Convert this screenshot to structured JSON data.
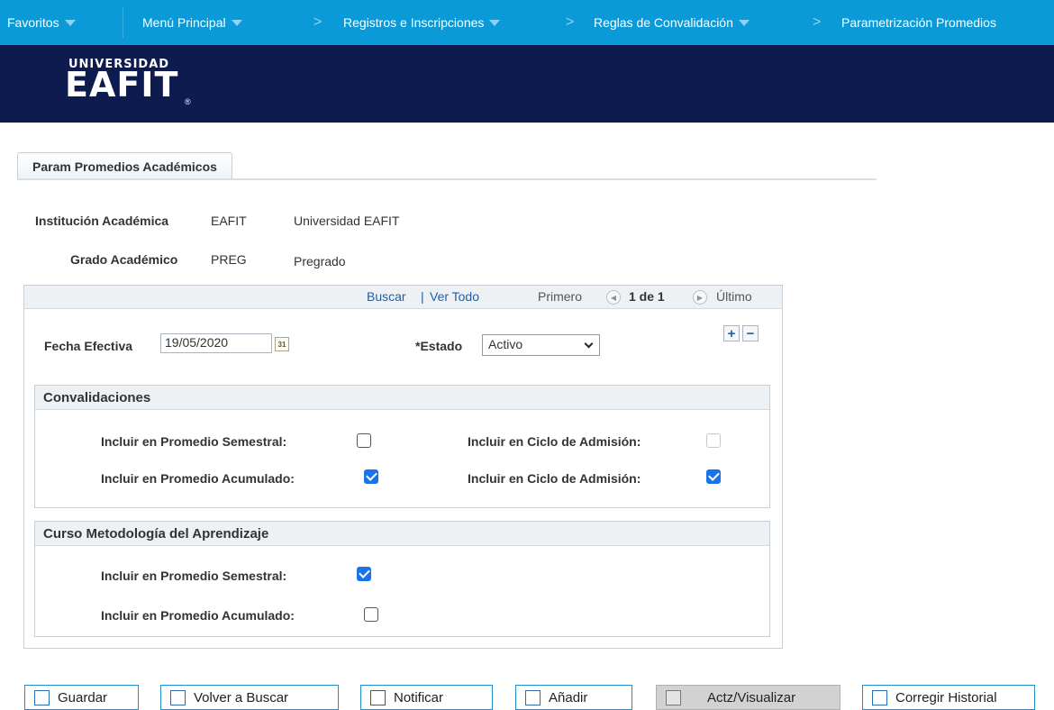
{
  "nav": {
    "favoritos": "Favoritos",
    "menu_principal": "Menú Principal",
    "registros": "Registros e Inscripciones",
    "reglas": "Reglas de Convalidación",
    "parametrizacion": "Parametrización Promedios",
    "separator": ">"
  },
  "logo": {
    "line1": "UNIVERSIDAD",
    "line2": "EAFIT",
    "reg": "®"
  },
  "tab": {
    "label": "Param Promedios Académicos"
  },
  "header_fields": {
    "institucion_label": "Institución Académica",
    "institucion_code": "EAFIT",
    "institucion_desc": "Universidad EAFIT",
    "grado_label": "Grado Académico",
    "grado_code": "PREG",
    "grado_desc": "Pregrado"
  },
  "grid_nav": {
    "buscar": "Buscar",
    "divider": "|",
    "ver_todo": "Ver Todo",
    "primero": "Primero",
    "counter": "1 de 1",
    "ultimo": "Último",
    "prev_icon": "circle-left-arrow-icon",
    "next_icon": "circle-right-arrow-icon"
  },
  "row_buttons": {
    "add": "+",
    "remove": "−"
  },
  "fields": {
    "fecha_label": "Fecha Efectiva",
    "fecha_value": "19/05/2020",
    "calendar_icon": "calendar-icon",
    "calendar_text": "31",
    "estado_label": "*Estado",
    "estado_value": "Activo"
  },
  "convalidaciones": {
    "title": "Convalidaciones",
    "sem_label": "Incluir en Promedio Semestral:",
    "sem_checked": false,
    "acum_label": "Incluir en Promedio Acumulado:",
    "acum_checked": true,
    "ciclo1_label": "Incluir en Ciclo de Admisión:",
    "ciclo1_checked": false,
    "ciclo1_disabled": true,
    "ciclo2_label": "Incluir en Ciclo de Admisión:",
    "ciclo2_checked": true
  },
  "metodologia": {
    "title": "Curso Metodología del Aprendizaje",
    "sem_label": "Incluir en Promedio Semestral:",
    "sem_checked": true,
    "acum_label": "Incluir en Promedio Acumulado:",
    "acum_checked": false
  },
  "buttons": {
    "guardar": "Guardar",
    "volver": "Volver a Buscar",
    "notificar": "Notificar",
    "anadir": "Añadir",
    "actz": "Actz/Visualizar",
    "corregir": "Corregir Historial"
  },
  "colors": {
    "topnav_bg": "#0a9ad8",
    "banner_bg": "#0d1b4f",
    "link": "#1f5ea8",
    "checkbox_on": "#1a73e8"
  }
}
